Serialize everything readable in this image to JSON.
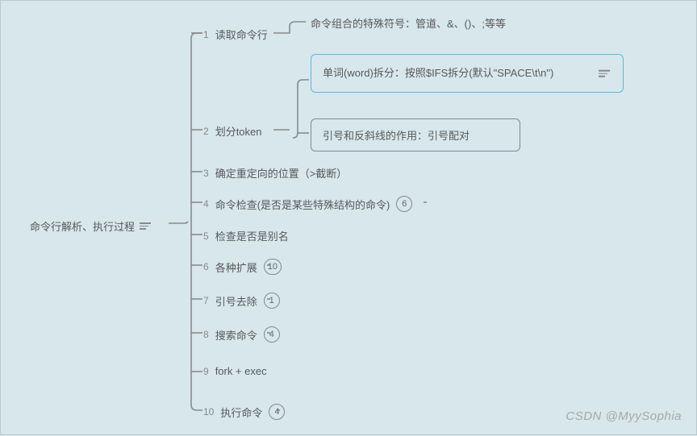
{
  "root": {
    "title": "命令行解析、执行过程"
  },
  "items": [
    {
      "num": "1",
      "label": "读取命令行"
    },
    {
      "num": "2",
      "label": "划分token"
    },
    {
      "num": "3",
      "label": "确定重定向的位置（>截断）"
    },
    {
      "num": "4",
      "label": "命令检查(是否是某些特殊结构的命令)",
      "badge": "6"
    },
    {
      "num": "5",
      "label": "检查是否是别名"
    },
    {
      "num": "6",
      "label": "各种扩展",
      "badge": "10"
    },
    {
      "num": "7",
      "label": "引号去除",
      "badge": "1"
    },
    {
      "num": "8",
      "label": "搜索命令",
      "badge": "4"
    },
    {
      "num": "9",
      "label": "fork + exec"
    },
    {
      "num": "10",
      "label": "执行命令",
      "badge": "4"
    }
  ],
  "sub1": {
    "text": "命令组合的特殊符号：管道、&、()、;等等"
  },
  "box1": {
    "text": "单词(word)拆分：按照$IFS拆分(默认\"SPACE\\t\\n\")"
  },
  "box2": {
    "text": "引号和反斜线的作用：引号配对"
  },
  "watermark": "CSDN @MyySophia"
}
